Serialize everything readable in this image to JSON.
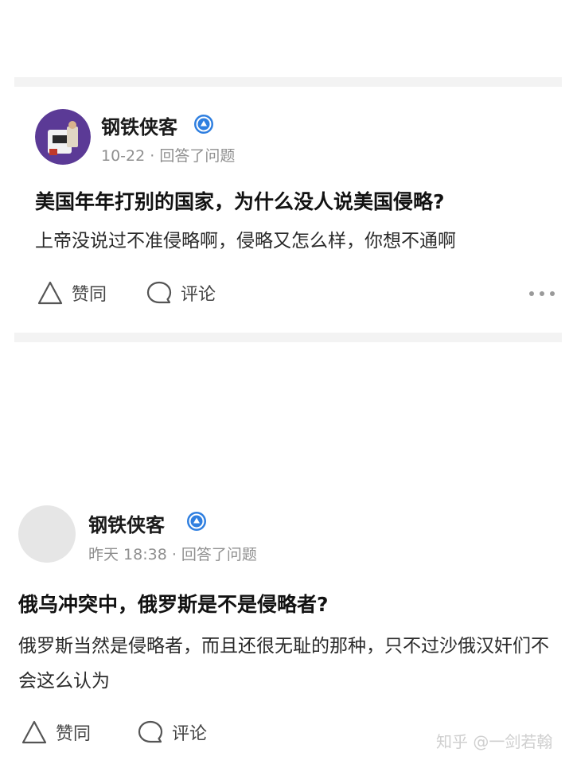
{
  "posts": [
    {
      "author": "钢铁侠客",
      "meta": "10-22 · 回答了问题",
      "title": "美国年年打别的国家，为什么没人说美国侵略?",
      "excerpt": "上帝没说过不准侵略啊，侵略又怎么样，你想不通啊",
      "like_label": "赞同",
      "comment_label": "评论"
    },
    {
      "author": "钢铁侠客",
      "meta": "昨天 18:38 · 回答了问题",
      "title": "俄乌冲突中，俄罗斯是不是侵略者?",
      "excerpt": "俄罗斯当然是侵略者，而且还很无耻的那种，只不过沙俄汉奸们不会这么认为",
      "like_label": "赞同",
      "comment_label": "评论"
    }
  ],
  "watermark": "知乎 @一剑若翰",
  "colors": {
    "verified": "#2f7fe0",
    "avatar_purple": "#5b3a96",
    "separator": "#f3f3f3"
  },
  "icons": [
    "verified-badge-icon",
    "upvote-triangle-icon",
    "comment-bubble-icon",
    "more-dots-icon"
  ]
}
